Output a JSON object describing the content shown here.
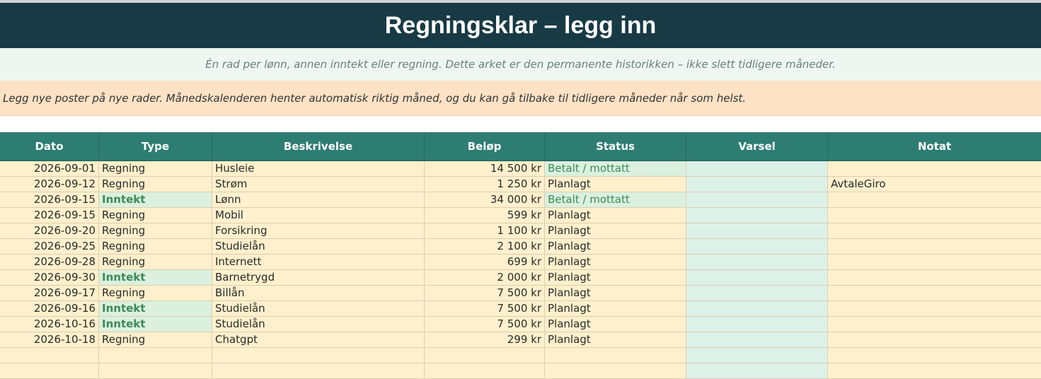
{
  "title": "Regningsklar – legg inn",
  "subtitle": "Én rad per lønn, annen inntekt eller regning. Dette arket er den permanente historikken – ikke slett tidligere måneder.",
  "note": "Legg nye poster på nye rader. Månedskalenderen henter automatisk riktig måned, og du kan gå tilbake til tidligere måneder når som helst.",
  "columns": [
    "Dato",
    "Type",
    "Beskrivelse",
    "Beløp",
    "Status",
    "Varsel",
    "Notat"
  ],
  "rows": [
    {
      "date": "2026-09-01",
      "type": "Regning",
      "desc": "Husleie",
      "amount": "14 500 kr",
      "status": "Betalt / mottatt",
      "varsel": "",
      "note": ""
    },
    {
      "date": "2026-09-12",
      "type": "Regning",
      "desc": "Strøm",
      "amount": "1 250 kr",
      "status": "Planlagt",
      "varsel": "",
      "note": "AvtaleGiro"
    },
    {
      "date": "2026-09-15",
      "type": "Inntekt",
      "desc": "Lønn",
      "amount": "34 000 kr",
      "status": "Betalt / mottatt",
      "varsel": "",
      "note": ""
    },
    {
      "date": "2026-09-15",
      "type": "Regning",
      "desc": "Mobil",
      "amount": "599 kr",
      "status": "Planlagt",
      "varsel": "",
      "note": ""
    },
    {
      "date": "2026-09-20",
      "type": "Regning",
      "desc": "Forsikring",
      "amount": "1 100 kr",
      "status": "Planlagt",
      "varsel": "",
      "note": ""
    },
    {
      "date": "2026-09-25",
      "type": "Regning",
      "desc": "Studielån",
      "amount": "2 100 kr",
      "status": "Planlagt",
      "varsel": "",
      "note": ""
    },
    {
      "date": "2026-09-28",
      "type": "Regning",
      "desc": "Internett",
      "amount": "699 kr",
      "status": "Planlagt",
      "varsel": "",
      "note": ""
    },
    {
      "date": "2026-09-30",
      "type": "Inntekt",
      "desc": "Barnetrygd",
      "amount": "2 000 kr",
      "status": "Planlagt",
      "varsel": "",
      "note": ""
    },
    {
      "date": "2026-09-17",
      "type": "Regning",
      "desc": "Billån",
      "amount": "7 500 kr",
      "status": "Planlagt",
      "varsel": "",
      "note": ""
    },
    {
      "date": "2026-09-16",
      "type": "Inntekt",
      "desc": "Studielån",
      "amount": "7 500 kr",
      "status": "Planlagt",
      "varsel": "",
      "note": ""
    },
    {
      "date": "2026-10-16",
      "type": "Inntekt",
      "desc": "Studielån",
      "amount": "7 500 kr",
      "status": "Planlagt",
      "varsel": "",
      "note": ""
    },
    {
      "date": "2026-10-18",
      "type": "Regning",
      "desc": "Chatgpt",
      "amount": "299 kr",
      "status": "Planlagt",
      "varsel": "",
      "note": ""
    },
    {
      "date": "",
      "type": "",
      "desc": "",
      "amount": "",
      "status": "",
      "varsel": "",
      "note": ""
    },
    {
      "date": "",
      "type": "",
      "desc": "",
      "amount": "",
      "status": "",
      "varsel": "",
      "note": ""
    }
  ],
  "colors": {
    "title_bg": "#183a45",
    "header_bg": "#2e7d72",
    "row_bg": "#fef0cc",
    "income_bg": "#dbf0de",
    "income_text": "#3d8a5a",
    "varsel_bg": "#dcf1e8",
    "note_bg": "#fde2c6"
  }
}
